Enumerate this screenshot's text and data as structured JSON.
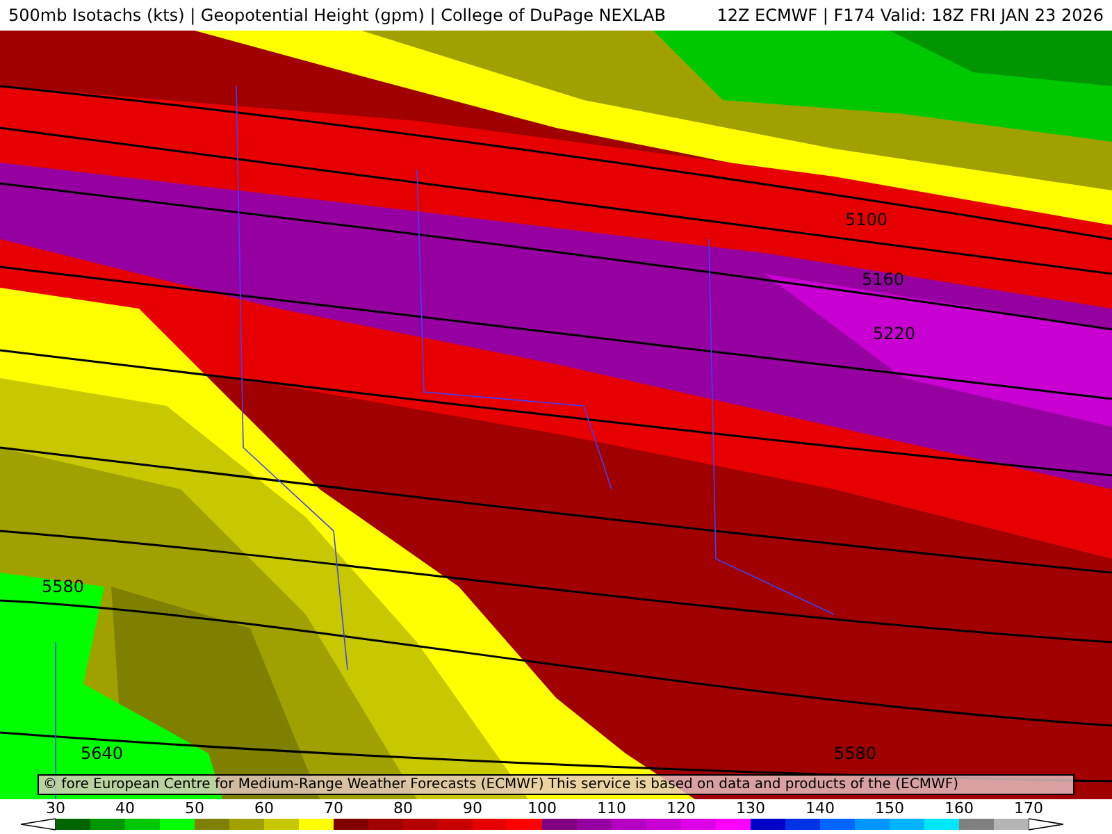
{
  "header": {
    "title": "500mb Isotachs (kts) | Geopotential Height (gpm) | College of DuPage NEXLAB",
    "run": "12Z ECMWF | F174 Valid: 18Z FRI JAN 23 2026"
  },
  "map": {
    "contour_labels": [
      {
        "text": "5100"
      },
      {
        "text": "5160"
      },
      {
        "text": "5220"
      },
      {
        "text": "5580"
      },
      {
        "text": "5640"
      },
      {
        "text": "5580"
      }
    ],
    "disclaimer": "© fore European Centre for Medium-Range Weather Forecasts (ECMWF)  This service is based on data and products of the (ECMWF)"
  },
  "legend": {
    "ticks": [
      "30",
      "40",
      "50",
      "60",
      "70",
      "80",
      "90",
      "100",
      "110",
      "120",
      "130",
      "140",
      "150",
      "160",
      "170"
    ],
    "bins": [
      {
        "color": "#006400"
      },
      {
        "color": "#009600"
      },
      {
        "color": "#00c800"
      },
      {
        "color": "#00ff00"
      },
      {
        "color": "#808000"
      },
      {
        "color": "#a0a000"
      },
      {
        "color": "#c8c800"
      },
      {
        "color": "#ffff00"
      },
      {
        "color": "#800000"
      },
      {
        "color": "#a00000"
      },
      {
        "color": "#b40000"
      },
      {
        "color": "#c80000"
      },
      {
        "color": "#e60000"
      },
      {
        "color": "#ff0000"
      },
      {
        "color": "#800080"
      },
      {
        "color": "#9600a0"
      },
      {
        "color": "#b400c0"
      },
      {
        "color": "#c800d2"
      },
      {
        "color": "#dc00e6"
      },
      {
        "color": "#ff00ff"
      },
      {
        "color": "#0000c8"
      },
      {
        "color": "#0032e6"
      },
      {
        "color": "#0064ff"
      },
      {
        "color": "#0096ff"
      },
      {
        "color": "#00b4ff"
      },
      {
        "color": "#00e6ff"
      },
      {
        "color": "#808080"
      },
      {
        "color": "#b4b4b4"
      }
    ]
  }
}
